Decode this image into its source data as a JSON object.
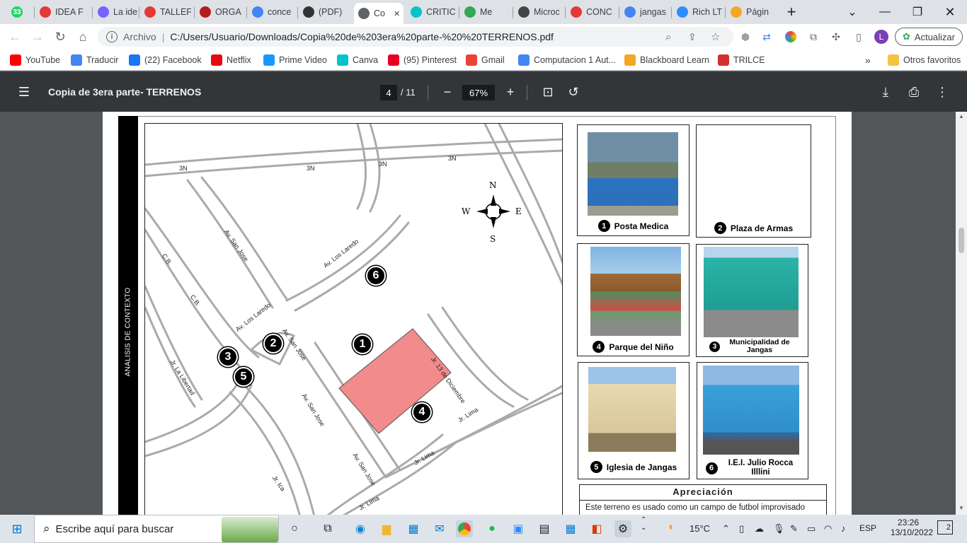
{
  "browser": {
    "tabs": [
      {
        "label": "",
        "icon": "whatsapp-icon",
        "color": "#25d366",
        "badge": "33"
      },
      {
        "label": "IDEA F",
        "icon": "target-icon",
        "color": "#e53935"
      },
      {
        "label": "La ide",
        "icon": "canva-icon",
        "color": "#7b61ff"
      },
      {
        "label": "TALLEF",
        "icon": "target-icon",
        "color": "#e53935"
      },
      {
        "label": "ORGA",
        "icon": "slides-icon",
        "color": "#b71c1c"
      },
      {
        "label": "conce",
        "icon": "google-icon",
        "color": "#4285f4"
      },
      {
        "label": "(PDF)",
        "icon": "academia-icon",
        "color": "#333333"
      },
      {
        "label": "Co",
        "icon": "globe-icon",
        "color": "#5f6368",
        "active": true
      },
      {
        "label": "CRITIC",
        "icon": "canva-icon",
        "color": "#00c4cc"
      },
      {
        "label": "Me",
        "icon": "mail-icon",
        "color": "#34a853"
      },
      {
        "label": "Microc",
        "icon": "pen-icon",
        "color": "#444444"
      },
      {
        "label": "CONC",
        "icon": "target-icon",
        "color": "#e53935"
      },
      {
        "label": "jangas",
        "icon": "google-icon",
        "color": "#4285f4"
      },
      {
        "label": "Rich LT",
        "icon": "zoom-icon",
        "color": "#2d8cff"
      },
      {
        "label": "Págin",
        "icon": "pencil-icon",
        "color": "#f5a623"
      }
    ],
    "new_tab": "+",
    "address": {
      "scheme": "Archivo",
      "url": "C:/Users/Usuario/Downloads/Copia%20de%203era%20parte-%20%20TERRENOS.pdf"
    },
    "profile_letter": "L",
    "update_label": "Actualizar",
    "bookmarks": [
      {
        "label": "YouTube",
        "icon": "youtube-icon",
        "color": "#ff0000"
      },
      {
        "label": "Traducir",
        "icon": "translate-icon",
        "color": "#4285f4"
      },
      {
        "label": "(22) Facebook",
        "icon": "facebook-icon",
        "color": "#1877f2"
      },
      {
        "label": "Netflix",
        "icon": "netflix-icon",
        "color": "#e50914"
      },
      {
        "label": "Prime Video",
        "icon": "prime-icon",
        "color": "#1a98ff"
      },
      {
        "label": "Canva",
        "icon": "canva-icon",
        "color": "#00c4cc"
      },
      {
        "label": "(95) Pinterest",
        "icon": "pinterest-icon",
        "color": "#e60023"
      },
      {
        "label": "Gmail",
        "icon": "gmail-icon",
        "color": "#ea4335"
      },
      {
        "label": "Computacion 1 Aut...",
        "icon": "google-icon",
        "color": "#4285f4"
      },
      {
        "label": "Blackboard Learn",
        "icon": "blackboard-icon",
        "color": "#f5a623"
      },
      {
        "label": "TRILCE",
        "icon": "trilce-icon",
        "color": "#d32f2f"
      }
    ],
    "bookmarks_more": "»",
    "other_favorites": "Otros favoritos"
  },
  "pdf": {
    "title": "Copia de 3era parte- TERRENOS",
    "page": "4",
    "total": "/ 11",
    "zoom": "67%"
  },
  "document": {
    "side_label": "ANALISIS DE CONTEXTO",
    "compass": {
      "n": "N",
      "s": "S",
      "e": "E",
      "w": "W"
    },
    "streets": [
      "3N",
      "3N",
      "3N",
      "3N",
      "Av. San Jose",
      "Av. Los Laredo",
      "C.B.",
      "C.B.",
      "Av. Los Laredo",
      "Av. San Jose",
      "Jr. La Libertad",
      "Jr. 13 de Diciembre",
      "Av. San Jose",
      "Jr. Lima",
      "Av. San Jose",
      "Jr. Lima",
      "Jr. Ica",
      "Jr. Lima"
    ],
    "markers": [
      "1",
      "2",
      "3",
      "4",
      "5",
      "6"
    ],
    "places": [
      {
        "num": "1",
        "label": "Posta Medica"
      },
      {
        "num": "2",
        "label": "Plaza de Armas"
      },
      {
        "num": "4",
        "label": "Parque del Niño"
      },
      {
        "num": "3",
        "label": "Municipalidad de Jangas"
      },
      {
        "num": "5",
        "label": "Iglesia de Jangas"
      },
      {
        "num": "6",
        "label": "I.E.I. Julio Rocca Illlini"
      }
    ],
    "appreciation_title": "Apreciación",
    "appreciation_text": "Este  terreno es usado como un campo de futbol improvisado"
  },
  "taskbar": {
    "search_placeholder": "Escribe aquí para buscar",
    "weather": "15°C",
    "lang": "ESP",
    "time": "23:26",
    "date": "13/10/2022",
    "notifications": "2"
  }
}
